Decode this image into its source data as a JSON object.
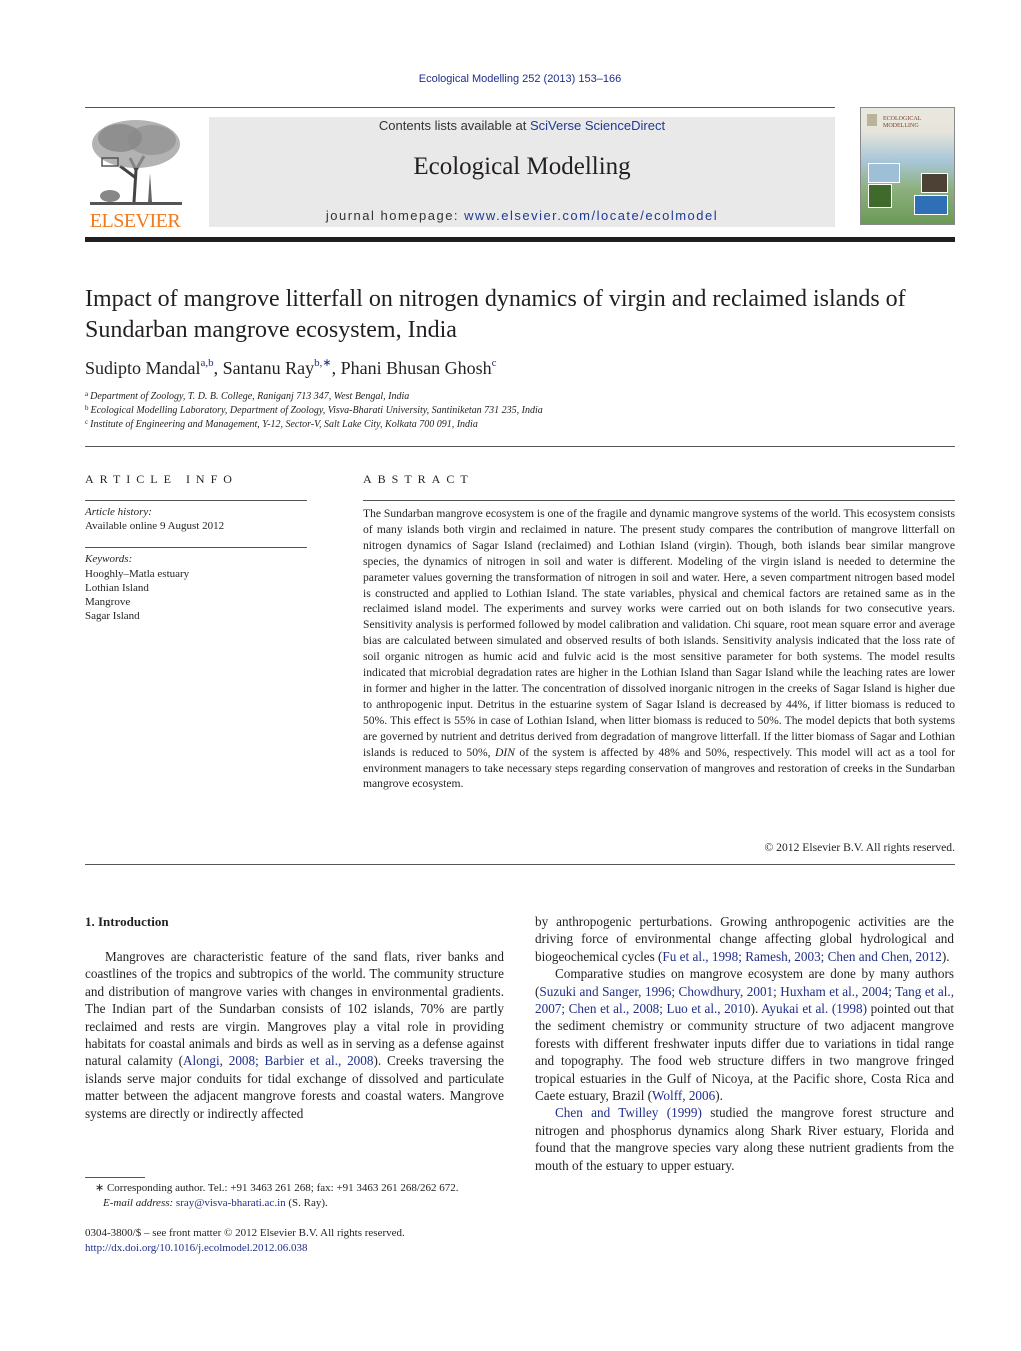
{
  "header": {
    "journal_ref": "Ecological Modelling 252 (2013) 153–166",
    "contents_prefix": "Contents lists available at ",
    "contents_link": "SciVerse ScienceDirect",
    "journal_title": "Ecological Modelling",
    "homepage_prefix": "journal homepage: ",
    "homepage_link": "www.elsevier.com/locate/ecolmodel",
    "publisher_logo_text": "ELSEVIER",
    "cover_title": "ECOLOGICAL MODELLING"
  },
  "article": {
    "title": "Impact of mangrove litterfall on nitrogen dynamics of virgin and reclaimed islands of Sundarban mangrove ecosystem, India",
    "authors": [
      {
        "name": "Sudipto Mandal",
        "sup": "a,b",
        "sep": ", "
      },
      {
        "name": "Santanu Ray",
        "sup": "b,∗",
        "sep": ", "
      },
      {
        "name": "Phani Bhusan Ghosh",
        "sup": "c",
        "sep": ""
      }
    ],
    "affiliations": [
      {
        "label": "a",
        "text": "Department of Zoology, T. D. B. College, Raniganj 713 347, West Bengal, India"
      },
      {
        "label": "b",
        "text": "Ecological Modelling Laboratory, Department of Zoology, Visva-Bharati University, Santiniketan 731 235, India"
      },
      {
        "label": "c",
        "text": "Institute of Engineering and Management, Y-12, Sector-V, Salt Lake City, Kolkata 700 091, India"
      }
    ]
  },
  "article_info": {
    "heading": "ARTICLE INFO",
    "history_label": "Article history:",
    "history_value": "Available online 9 August 2012",
    "keywords_label": "Keywords:",
    "keywords": [
      "Hooghly–Matla estuary",
      "Lothian Island",
      "Mangrove",
      "Sagar Island"
    ]
  },
  "abstract": {
    "heading": "ABSTRACT",
    "text_before_din": "The Sundarban mangrove ecosystem is one of the fragile and dynamic mangrove systems of the world. This ecosystem consists of many islands both virgin and reclaimed in nature. The present study compares the contribution of mangrove litterfall on nitrogen dynamics of Sagar Island (reclaimed) and Lothian Island (virgin). Though, both islands bear similar mangrove species, the dynamics of nitrogen in soil and water is different. Modeling of the virgin island is needed to determine the parameter values governing the transformation of nitrogen in soil and water. Here, a seven compartment nitrogen based model is constructed and applied to Lothian Island. The state variables, physical and chemical factors are retained same as in the reclaimed island model. The experiments and survey works were carried out on both islands for two consecutive years. Sensitivity analysis is performed followed by model calibration and validation. Chi square, root mean square error and average bias are calculated between simulated and observed results of both islands. Sensitivity analysis indicated that the loss rate of soil organic nitrogen as humic acid and fulvic acid is the most sensitive parameter for both systems. The model results indicated that microbial degradation rates are higher in the Lothian Island than Sagar Island while the leaching rates are lower in former and higher in the latter. The concentration of dissolved inorganic nitrogen in the creeks of Sagar Island is higher due to anthropogenic input. Detritus in the estuarine system of Sagar Island is decreased by 44%, if litter biomass is reduced to 50%. This effect is 55% in case of Lothian Island, when litter biomass is reduced to 50%. The model depicts that both systems are governed by nutrient and detritus derived from degradation of mangrove litterfall. If the litter biomass of Sagar and Lothian islands is reduced to 50%, ",
    "din": "DIN",
    "text_after_din": " of the system is affected by 48% and 50%, respectively. This model will act as a tool for environment managers to take necessary steps regarding conservation of mangroves and restoration of creeks in the Sundarban mangrove ecosystem.",
    "copyright": "© 2012 Elsevier B.V. All rights reserved."
  },
  "introduction": {
    "heading": "1.  Introduction",
    "left_p1_a": "Mangroves are characteristic feature of the sand flats, river banks and coastlines of the tropics and subtropics of the world. The community structure and distribution of mangrove varies with changes in environmental gradients. The Indian part of the Sundarban consists of 102 islands, 70% are partly reclaimed and rests are virgin. Mangroves play a vital role in providing habitats for coastal animals and birds as well as in serving as a defense against natural calamity (",
    "left_p1_cite": "Alongi, 2008; Barbier et al., 2008",
    "left_p1_b": "). Creeks traversing the islands serve major conduits for tidal exchange of dissolved and particulate matter between the adjacent mangrove forests and coastal waters. Mangrove systems are directly or indirectly affected",
    "right_p1_a": "by anthropogenic perturbations. Growing anthropogenic activities are the driving force of environmental change affecting global hydrological and biogeochemical cycles (",
    "right_p1_cite": "Fu et al., 1998; Ramesh, 2003; Chen and Chen, 2012",
    "right_p1_b": ").",
    "right_p2_a": "Comparative studies on mangrove ecosystem are done by many authors (",
    "right_p2_cite1": "Suzuki and Sanger, 1996; Chowdhury, 2001; Huxham et al., 2004; Tang et al., 2007; Chen et al., 2008; Luo et al., 2010",
    "right_p2_b": "). ",
    "right_p2_cite2": "Ayukai et al. (1998)",
    "right_p2_c": " pointed out that the sediment chemistry or community structure of two adjacent mangrove forests with different freshwater inputs differ due to variations in tidal range and topography. The food web structure differs in two mangrove fringed tropical estuaries in the Gulf of Nicoya, at the Pacific shore, Costa Rica and Caete estuary, Brazil (",
    "right_p2_cite3": "Wolff, 2006",
    "right_p2_d": ").",
    "right_p3_cite": "Chen and Twilley (1999)",
    "right_p3_a": " studied the mangrove forest structure and nitrogen and phosphorus dynamics along Shark River estuary, Florida and found that the mangrove species vary along these nutrient gradients from the mouth of the estuary to upper estuary."
  },
  "footnote": {
    "star": "∗",
    "line1": " Corresponding author. Tel.: +91 3463 261 268; fax: +91 3463 261 268/262 672.",
    "email_label": "E-mail address:",
    "email": "sray@visva-bharati.ac.in",
    "email_suffix": " (S. Ray)."
  },
  "front_matter": {
    "issn_line": "0304-3800/$ – see front matter © 2012 Elsevier B.V. All rights reserved.",
    "doi": "http://dx.doi.org/10.1016/j.ecolmodel.2012.06.038"
  },
  "colors": {
    "link": "#1f2f8a",
    "elsevier_orange": "#f07a1e",
    "masthead_bg": "#e9e9ea",
    "text": "#231f20"
  }
}
